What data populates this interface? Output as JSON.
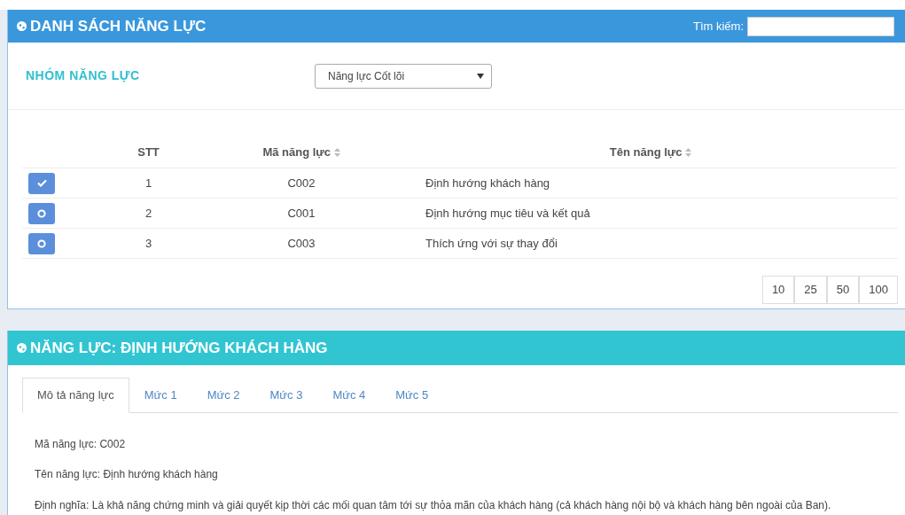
{
  "list_panel": {
    "title": "DANH SÁCH NĂNG LỰC",
    "search": {
      "label": "Tìm kiếm:"
    },
    "group": {
      "label": "NHÓM NĂNG LỰC",
      "value": "Năng lực Cốt lõi"
    },
    "table": {
      "columns": [
        {
          "label": "STT",
          "sortable": false
        },
        {
          "label": "Mã năng lực",
          "sortable": true
        },
        {
          "label": "Tên năng lực",
          "sortable": true
        }
      ],
      "rows": [
        {
          "selected": true,
          "cells": [
            "1",
            "C002",
            "Định hướng khách hàng"
          ]
        },
        {
          "selected": false,
          "cells": [
            "2",
            "C001",
            "Định hướng mục tiêu và kết quả"
          ]
        },
        {
          "selected": false,
          "cells": [
            "3",
            "C003",
            "Thích ứng với sự thay đổi"
          ]
        }
      ]
    },
    "page_sizes": [
      "10",
      "25",
      "50",
      "100"
    ]
  },
  "detail_panel": {
    "title": "NĂNG LỰC: ĐỊNH HƯỚNG KHÁCH HÀNG",
    "tabs": [
      {
        "label": "Mô tả năng lực",
        "selected": true
      },
      {
        "label": "Mức 1",
        "selected": false
      },
      {
        "label": "Mức 2",
        "selected": false
      },
      {
        "label": "Mức 3",
        "selected": false
      },
      {
        "label": "Mức 4",
        "selected": false
      },
      {
        "label": "Mức 5",
        "selected": false
      }
    ],
    "lines": [
      "Mã năng lực: C002",
      "Tên năng lực: Định hướng khách hàng",
      "Định nghĩa: Là khả năng chứng minh và giải quyết kịp thời các mối quan tâm tới sự thỏa mãn của khách hàng (cả khách hàng nội bộ và khách hàng bên ngoài của Ban)."
    ]
  }
}
